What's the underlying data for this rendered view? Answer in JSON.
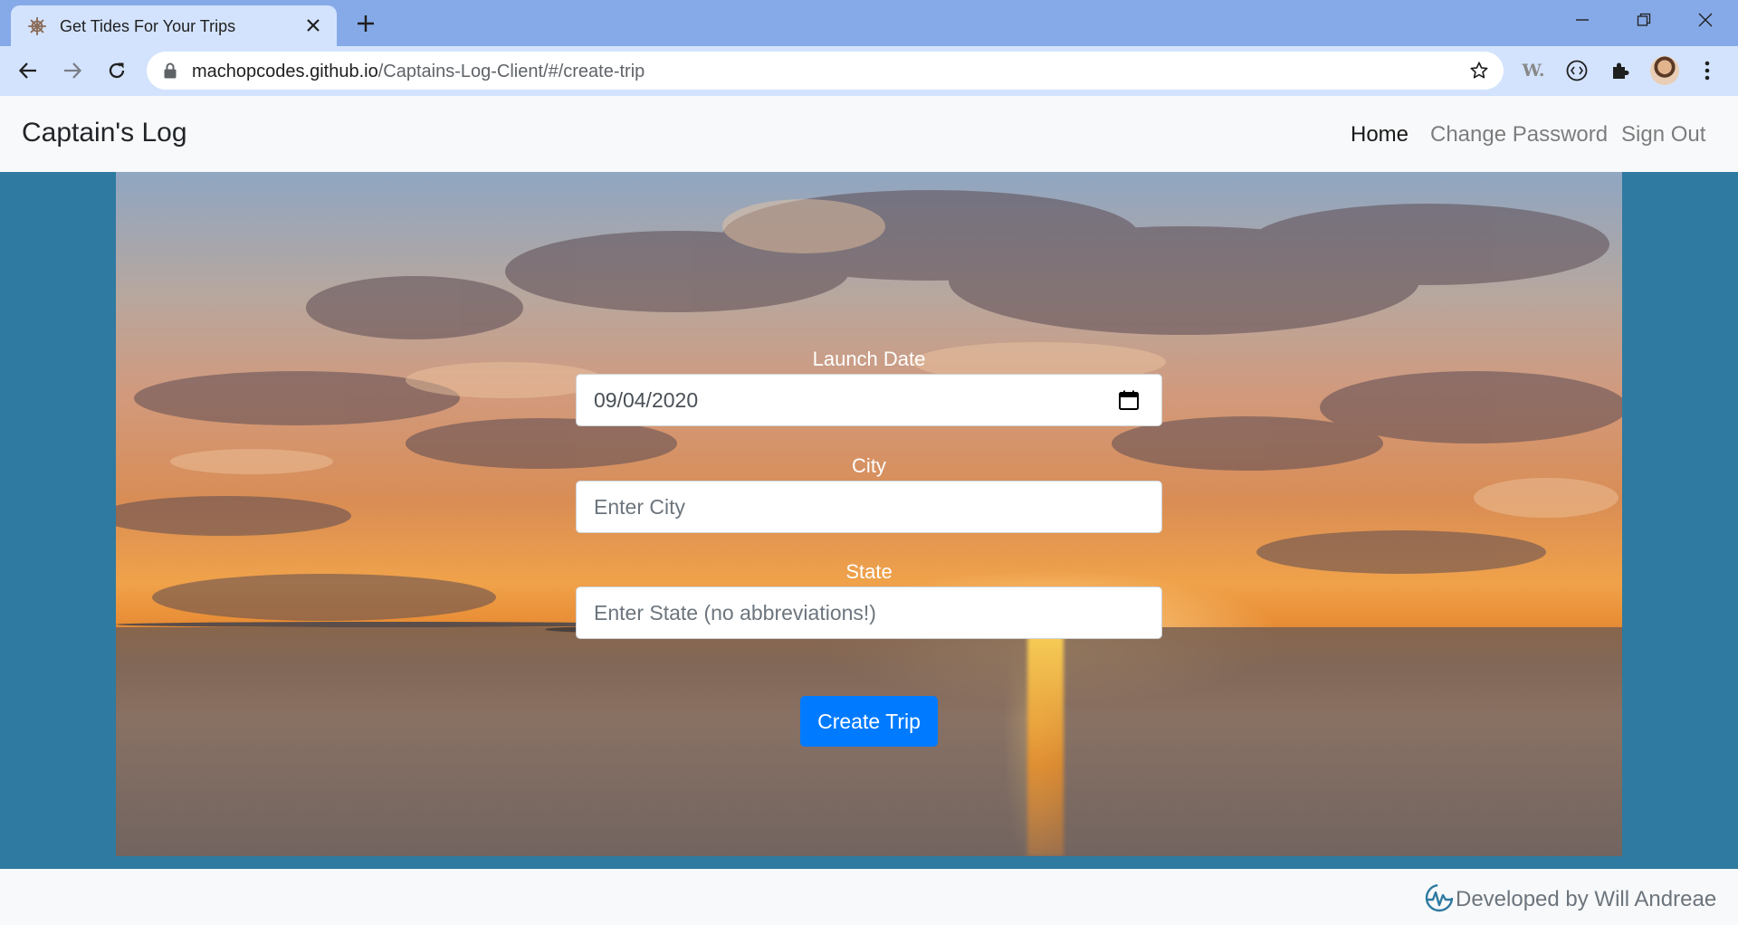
{
  "browser": {
    "tab_title": "Get Tides For Your Trips",
    "url_host": "machopcodes.github.io",
    "url_path": "/Captains-Log-Client/#/create-trip",
    "extension_w_label": "W."
  },
  "app": {
    "brand": "Captain's Log",
    "nav": {
      "home": "Home",
      "change_password": "Change Password",
      "sign_out": "Sign Out"
    }
  },
  "form": {
    "launch_date_label": "Launch Date",
    "launch_date_value": "09/04/2020",
    "city_label": "City",
    "city_placeholder": "Enter City",
    "state_label": "State",
    "state_placeholder": "Enter State (no abbreviations!)",
    "submit_label": "Create Trip"
  },
  "footer": {
    "credit": "Developed by Will Andreae"
  },
  "colors": {
    "page_bg": "#2e7aa1",
    "primary_button": "#007bff",
    "navbar_bg": "#f8f9fa",
    "chrome_tabbar": "#86aae8",
    "chrome_toolbar": "#d3e3fd"
  },
  "icons": {
    "tab_favicon": "ship-wheel-icon",
    "calendar": "calendar-icon",
    "footer_logo": "developer-logo-icon"
  }
}
